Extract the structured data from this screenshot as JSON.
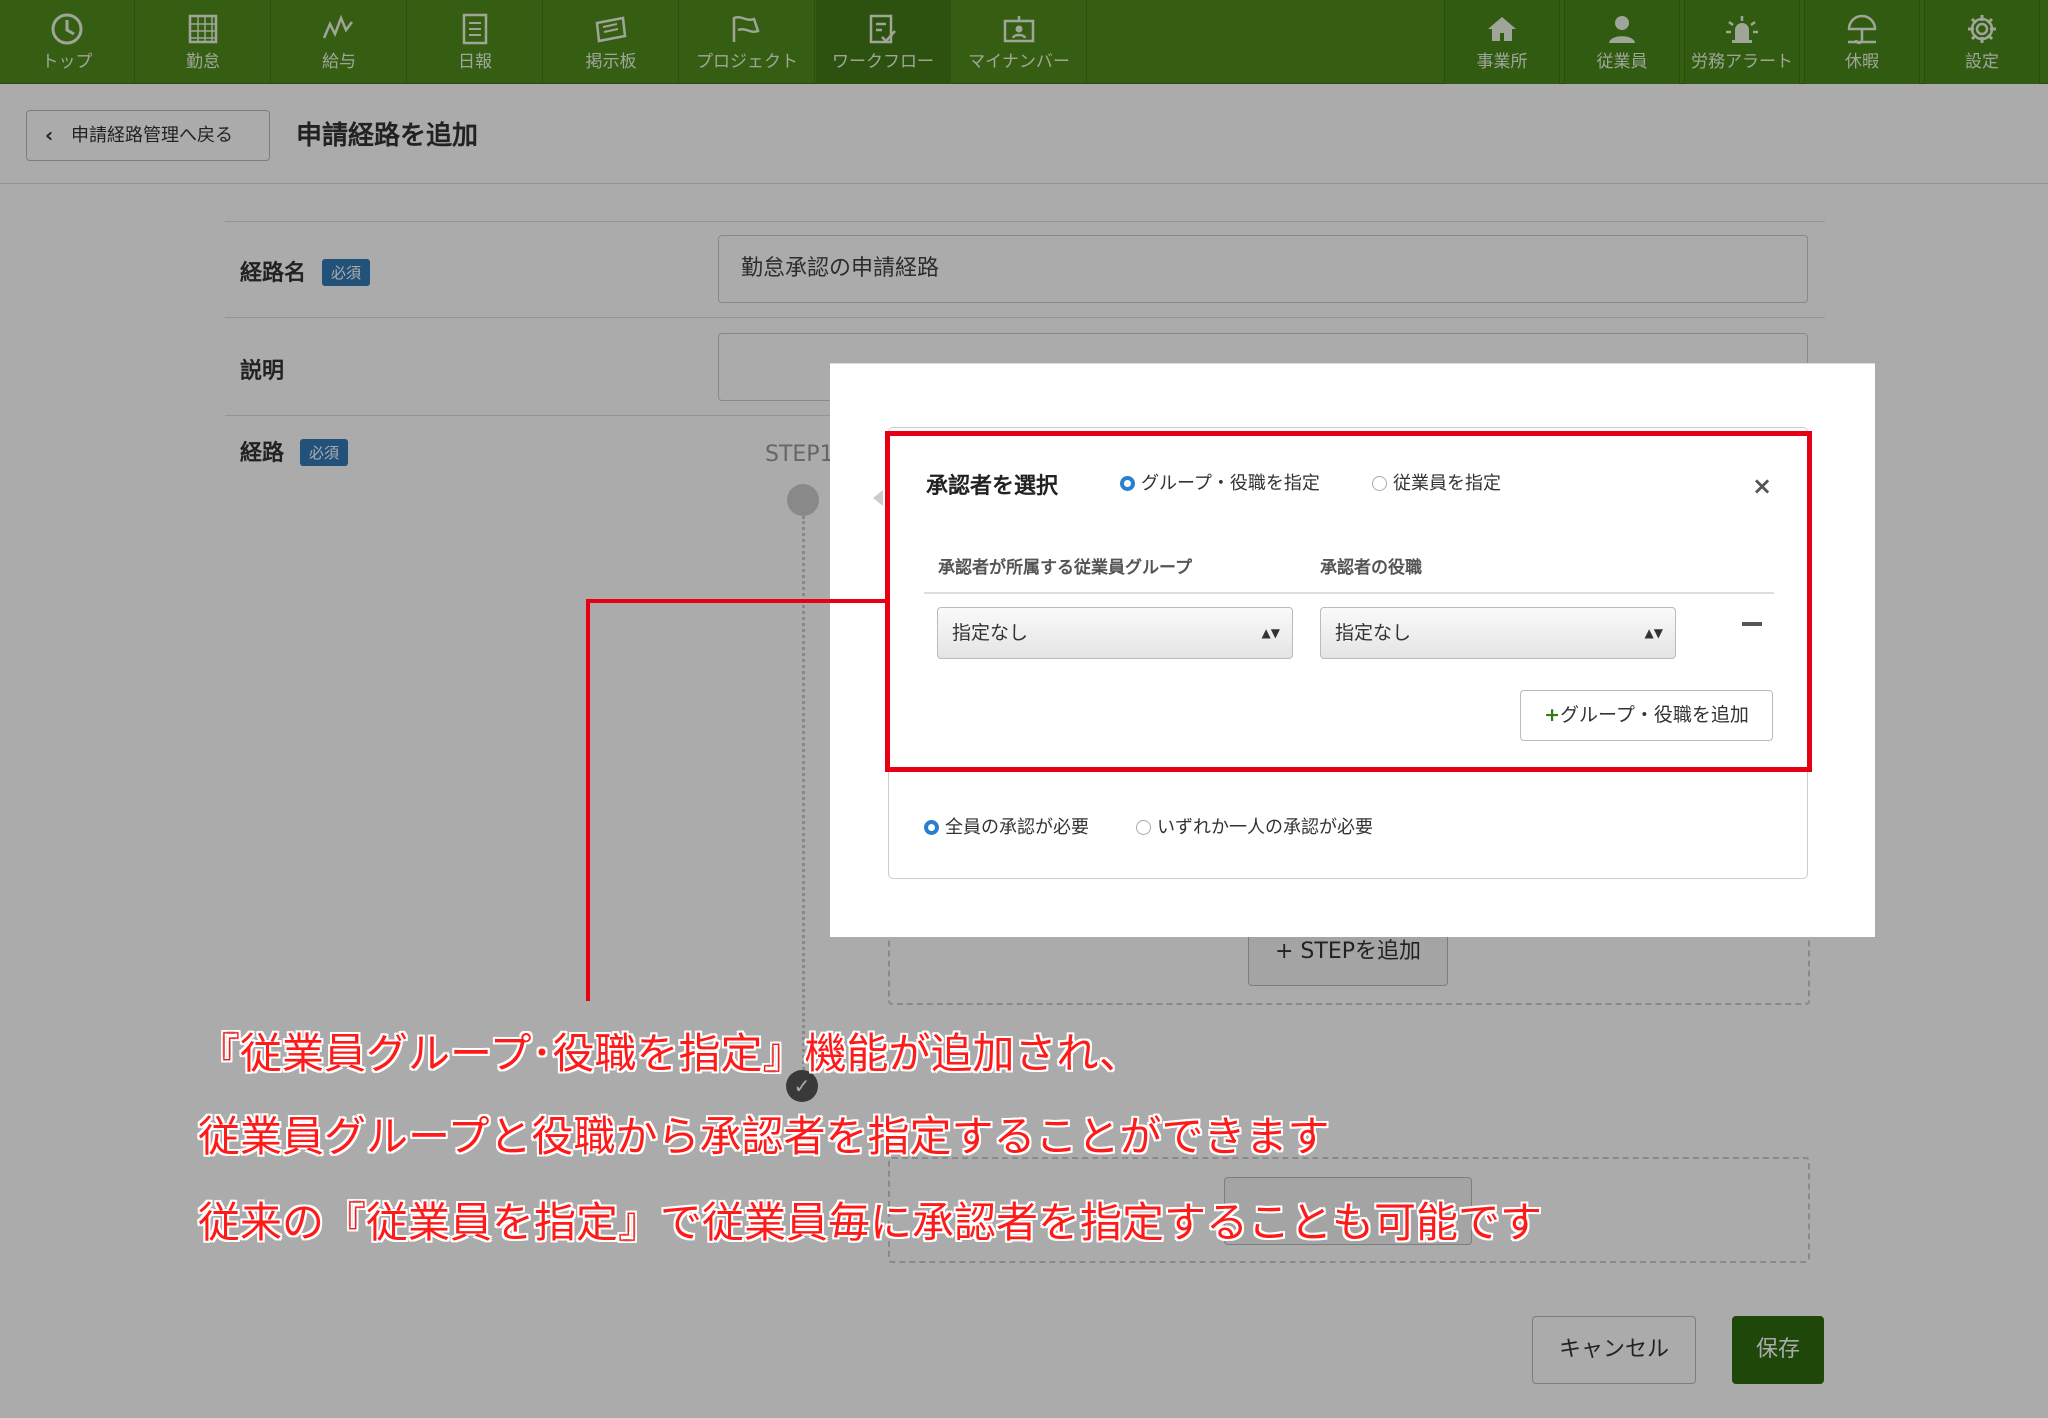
{
  "navbar": {
    "left_items": [
      {
        "label": "トップ",
        "icon": "clock-icon"
      },
      {
        "label": "勤怠",
        "icon": "grid-icon"
      },
      {
        "label": "給与",
        "icon": "zigzag-chart-icon"
      },
      {
        "label": "日報",
        "icon": "document-icon"
      },
      {
        "label": "掲示板",
        "icon": "board-icon"
      },
      {
        "label": "プロジェクト",
        "icon": "flag-icon"
      },
      {
        "label": "ワークフロー",
        "icon": "checklist-icon"
      },
      {
        "label": "マイナンバー",
        "icon": "id-card-icon"
      }
    ],
    "right_items": [
      {
        "label": "事業所",
        "icon": "home-icon"
      },
      {
        "label": "従業員",
        "icon": "person-icon"
      },
      {
        "label": "労務アラート",
        "icon": "siren-icon"
      },
      {
        "label": "休暇",
        "icon": "umbrella-icon"
      },
      {
        "label": "設定",
        "icon": "gear-icon"
      }
    ]
  },
  "header": {
    "back_label": "申請経路管理へ戻る",
    "title": "申請経路を追加"
  },
  "form": {
    "route_name_label": "経路名",
    "required_badge": "必須",
    "route_name_value": "勤怠承認の申請経路",
    "description_label": "説明",
    "route_label": "経路",
    "step_label": "STEP1"
  },
  "approver_panel": {
    "title": "承認者を選択",
    "radio_group_role": "グループ・役職を指定",
    "radio_employee": "従業員を指定",
    "close": "×",
    "col_group": "承認者が所属する従業員グループ",
    "col_role": "承認者の役職",
    "group_select_value": "指定なし",
    "role_select_value": "指定なし",
    "select_arrow": "▲▼",
    "add_group_role_label": "グループ・役職を追加",
    "plus": "+",
    "radio_all": "全員の承認が必要",
    "radio_any": "いずれか一人の承認が必要"
  },
  "actions": {
    "add_step_label": "STEPを追加",
    "plus": "+",
    "cancel": "キャンセル",
    "save": "保存"
  },
  "annotation": {
    "line1": "『従業員グループ･役職を指定』機能が追加され、",
    "line2": "従業員グループと役職から承認者を指定することができます",
    "line3": "従来の『従業員を指定』で従業員毎に承認者を指定することも可能です"
  },
  "colors": {
    "nav_green": "#4f8c1b",
    "save_green": "#2e6a0e",
    "badge_blue": "#3379b7",
    "annotation_red": "#e60012"
  }
}
